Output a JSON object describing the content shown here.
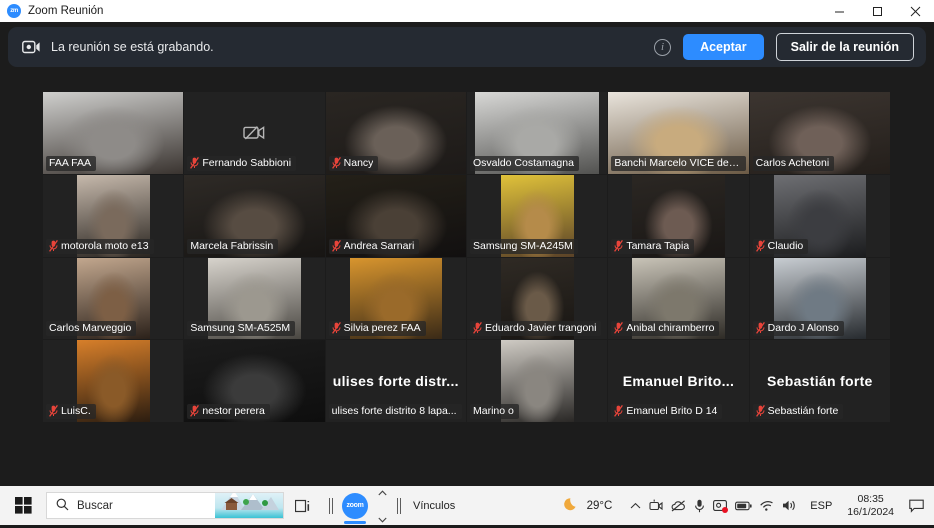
{
  "window": {
    "title": "Zoom Reunión",
    "app_icon": "zoom-icon",
    "minimize_label": "Minimizar",
    "maximize_label": "Maximizar",
    "close_label": "Cerrar"
  },
  "banner": {
    "icon": "recording-camera-icon",
    "text": "La reunión se está grabando.",
    "info_icon": "info-icon",
    "info_glyph": "i",
    "accept_label": "Aceptar",
    "leave_label": "Salir de la reunión",
    "accent_color": "#2d8cff",
    "background": "#252a32"
  },
  "gallery": {
    "active_speaker_border": "#8ede3f",
    "columns": 6,
    "rows": 4,
    "tiles": [
      {
        "name": "FAA FAA",
        "muted": false,
        "video": true,
        "video_fit": "full",
        "active": false,
        "display_name": ""
      },
      {
        "name": "Fernando Sabbioni",
        "muted": true,
        "video": false,
        "video_fit": "full",
        "active": false,
        "display_name": ""
      },
      {
        "name": "Nancy",
        "muted": true,
        "video": true,
        "video_fit": "full",
        "active": false,
        "display_name": ""
      },
      {
        "name": "Osvaldo Costamagna",
        "muted": false,
        "video": true,
        "video_fit": "wide",
        "active": false,
        "display_name": ""
      },
      {
        "name": "Banchi Marcelo VICE de F...",
        "muted": false,
        "video": true,
        "video_fit": "full",
        "active": true,
        "display_name": ""
      },
      {
        "name": "Carlos Achetoni",
        "muted": false,
        "video": true,
        "video_fit": "full",
        "active": false,
        "display_name": ""
      },
      {
        "name": "motorola moto e13",
        "muted": true,
        "video": true,
        "video_fit": "narrow",
        "active": false,
        "display_name": ""
      },
      {
        "name": "Marcela Fabrissin",
        "muted": false,
        "video": true,
        "video_fit": "full",
        "active": false,
        "display_name": ""
      },
      {
        "name": "Andrea Sarnari",
        "muted": true,
        "video": true,
        "video_fit": "full",
        "active": false,
        "display_name": ""
      },
      {
        "name": "Samsung SM-A245M",
        "muted": false,
        "video": true,
        "video_fit": "narrow",
        "active": false,
        "display_name": ""
      },
      {
        "name": "Tamara Tapia",
        "muted": true,
        "video": true,
        "video_fit": "narrowish",
        "active": false,
        "display_name": ""
      },
      {
        "name": "Claudio",
        "muted": true,
        "video": true,
        "video_fit": "narrowish",
        "active": false,
        "display_name": ""
      },
      {
        "name": "Carlos Marveggio",
        "muted": false,
        "video": true,
        "video_fit": "narrow",
        "active": false,
        "display_name": ""
      },
      {
        "name": "Samsung SM-A525M",
        "muted": false,
        "video": true,
        "video_fit": "narrowish",
        "active": false,
        "display_name": ""
      },
      {
        "name": "Silvia perez FAA",
        "muted": true,
        "video": true,
        "video_fit": "narrowish",
        "active": false,
        "display_name": ""
      },
      {
        "name": "Eduardo Javier trangoni",
        "muted": true,
        "video": true,
        "video_fit": "narrow",
        "active": false,
        "display_name": ""
      },
      {
        "name": "Anibal chiramberro",
        "muted": true,
        "video": true,
        "video_fit": "narrowish",
        "active": false,
        "display_name": ""
      },
      {
        "name": "Dardo J Alonso",
        "muted": true,
        "video": true,
        "video_fit": "narrowish",
        "active": false,
        "display_name": ""
      },
      {
        "name": "LuisC.",
        "muted": true,
        "video": true,
        "video_fit": "narrow",
        "active": false,
        "display_name": ""
      },
      {
        "name": "nestor perera",
        "muted": true,
        "video": true,
        "video_fit": "full",
        "active": false,
        "display_name": ""
      },
      {
        "name": "ulises forte distrito 8 lapa...",
        "muted": false,
        "video": false,
        "video_fit": "full",
        "active": false,
        "display_name": "ulises  forte  distr..."
      },
      {
        "name": "Marino o",
        "muted": false,
        "video": true,
        "video_fit": "narrow",
        "active": false,
        "display_name": ""
      },
      {
        "name": "Emanuel Brito D 14",
        "muted": true,
        "video": false,
        "video_fit": "full",
        "active": false,
        "display_name": "Emanuel  Brito..."
      },
      {
        "name": "Sebastián forte",
        "muted": true,
        "video": false,
        "video_fit": "full",
        "active": false,
        "display_name": "Sebastián forte"
      }
    ]
  },
  "taskbar": {
    "start_icon": "windows-start-icon",
    "search_placeholder": "Buscar",
    "search_icon": "search-icon",
    "weather_widget_icon": "weather-landscape-icon",
    "task_view_icon": "task-view-icon",
    "zoom_app_icon": "zoom-icon",
    "scroll_up_icon": "chevron-up-icon",
    "scroll_down_icon": "chevron-down-icon",
    "links_label": "Vínculos",
    "weather_icon": "moon-icon",
    "temperature": "29°C",
    "tray_overflow_icon": "chevron-up-icon",
    "tray": [
      "camera-off-icon",
      "cloud-off-icon",
      "microphone-icon",
      "screen-record-icon",
      "battery-icon",
      "wifi-icon",
      "volume-icon"
    ],
    "language": "ESP",
    "clock_time": "08:35",
    "clock_date": "16/1/2024",
    "notification_icon": "notification-icon"
  }
}
